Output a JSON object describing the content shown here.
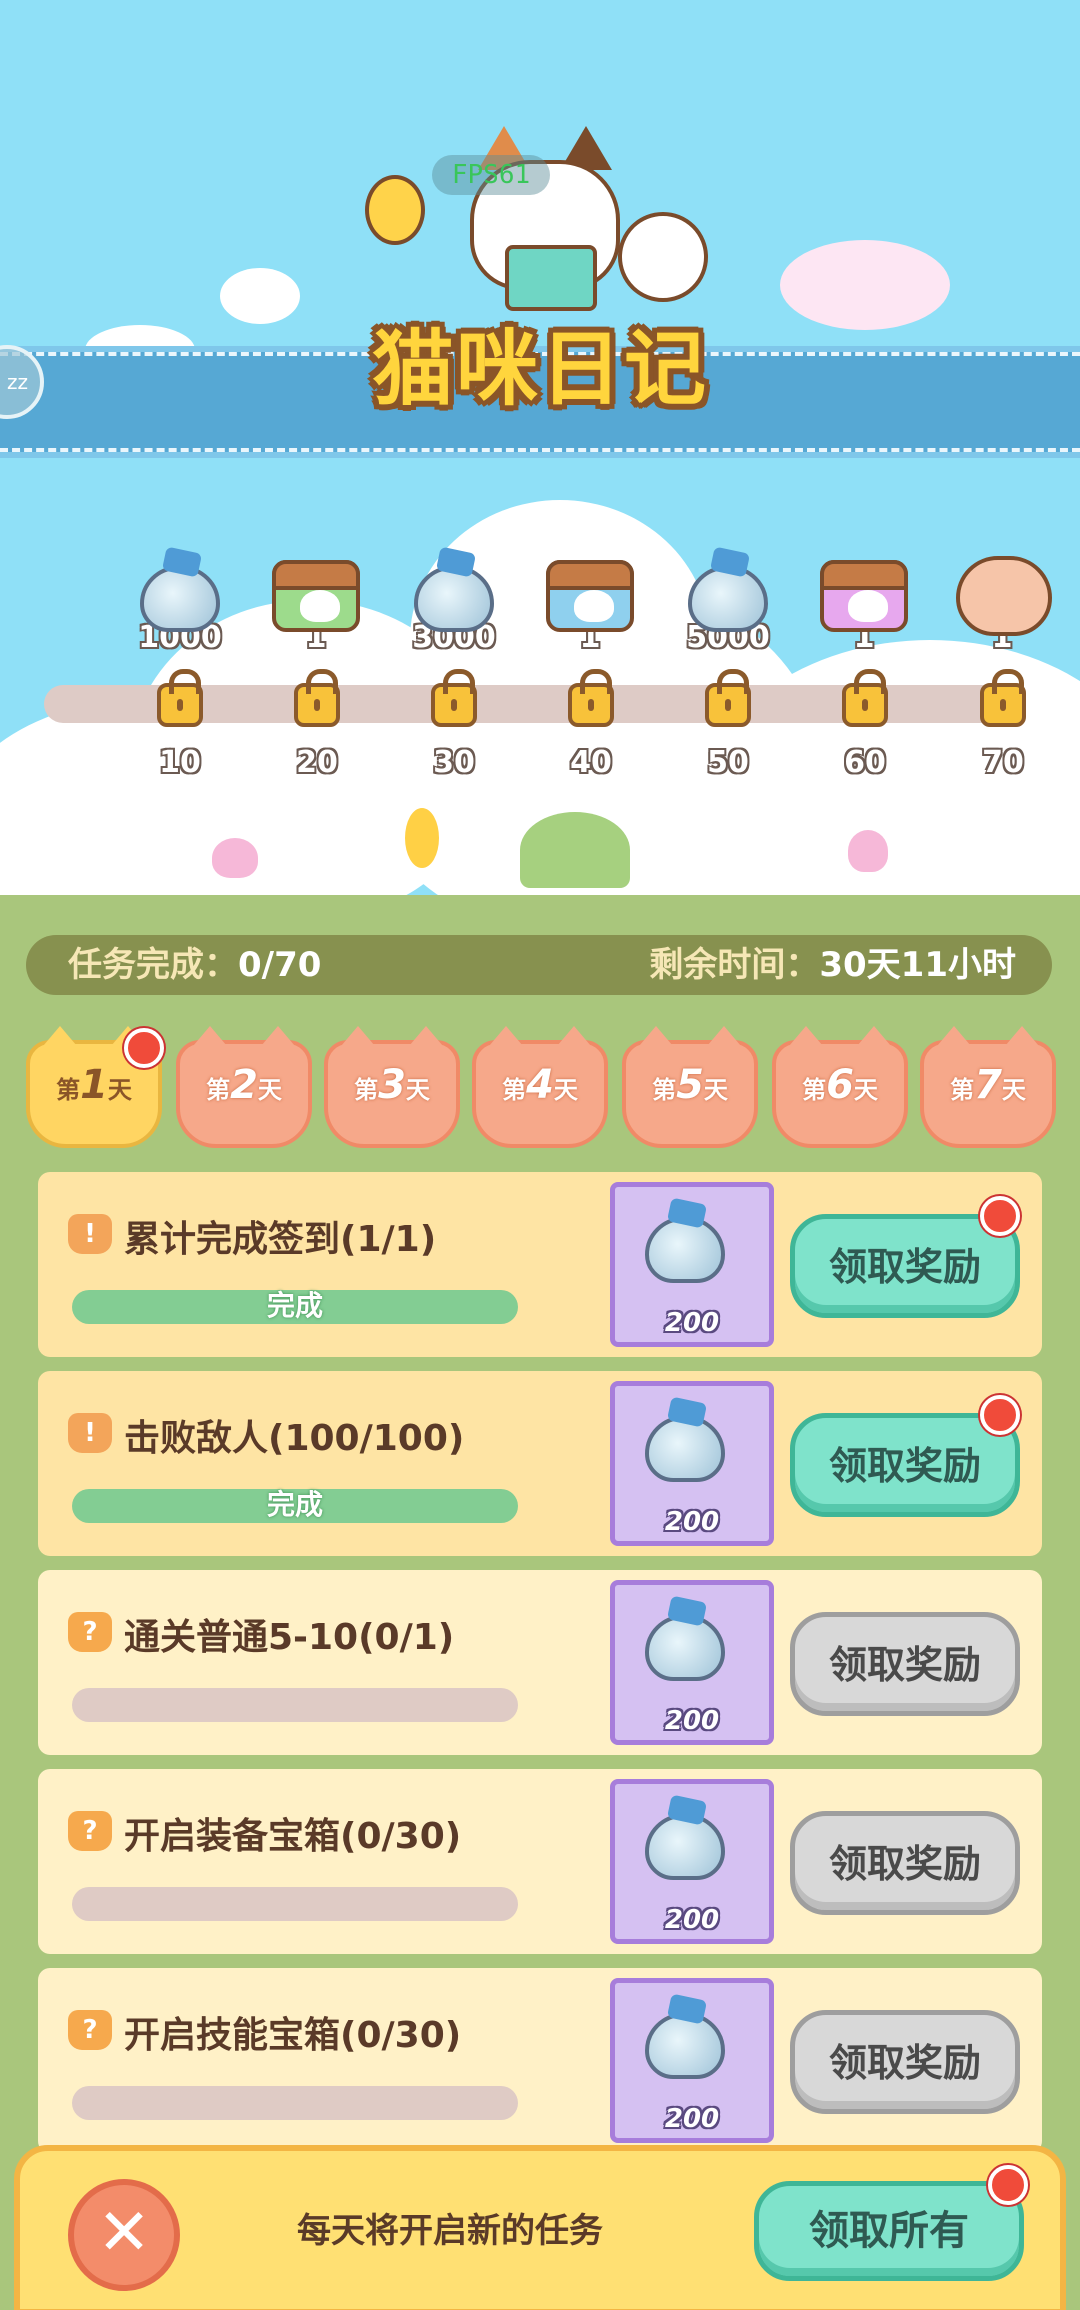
{
  "overlay": {
    "fps": "FPS61"
  },
  "side_button": {
    "label": "zz"
  },
  "header": {
    "title": "猫咪日记"
  },
  "track": {
    "rewards": [
      {
        "type": "diamond-bag",
        "amount": "1000"
      },
      {
        "type": "green-chest",
        "amount": "1"
      },
      {
        "type": "diamond-bag",
        "amount": "3000"
      },
      {
        "type": "blue-chest",
        "amount": "1"
      },
      {
        "type": "diamond-bag",
        "amount": "5000"
      },
      {
        "type": "purple-chest",
        "amount": "1"
      },
      {
        "type": "cat",
        "amount": "1"
      }
    ],
    "milestones": [
      "10",
      "20",
      "30",
      "40",
      "50",
      "60",
      "70"
    ]
  },
  "status": {
    "progress_label": "任务完成：",
    "progress_value": "0/70",
    "time_label": "剩余时间：",
    "time_value": "30天11小时"
  },
  "days": [
    {
      "prefix": "第",
      "num": "1",
      "suffix": "天"
    },
    {
      "prefix": "第",
      "num": "2",
      "suffix": "天"
    },
    {
      "prefix": "第",
      "num": "3",
      "suffix": "天"
    },
    {
      "prefix": "第",
      "num": "4",
      "suffix": "天"
    },
    {
      "prefix": "第",
      "num": "5",
      "suffix": "天"
    },
    {
      "prefix": "第",
      "num": "6",
      "suffix": "天"
    },
    {
      "prefix": "第",
      "num": "7",
      "suffix": "天"
    }
  ],
  "tasks": [
    {
      "badge": "!",
      "title": "累计完成签到(1/1)",
      "bar_text": "完成",
      "progress": 1.0,
      "reward_amount": "200",
      "button": "领取奖励"
    },
    {
      "badge": "!",
      "title": "击败敌人(100/100)",
      "bar_text": "完成",
      "progress": 1.0,
      "reward_amount": "200",
      "button": "领取奖励"
    },
    {
      "badge": "?",
      "title": "通关普通5-10(0/1)",
      "bar_text": "",
      "progress": 0.0,
      "reward_amount": "200",
      "button": "领取奖励"
    },
    {
      "badge": "?",
      "title": "开启装备宝箱(0/30)",
      "bar_text": "",
      "progress": 0.0,
      "reward_amount": "200",
      "button": "领取奖励"
    },
    {
      "badge": "?",
      "title": "开启技能宝箱(0/30)",
      "bar_text": "",
      "progress": 0.0,
      "reward_amount": "200",
      "button": "领取奖励"
    }
  ],
  "footer": {
    "close_symbol": "✕",
    "hint": "每天将开启新的任务",
    "claim_all": "领取所有"
  },
  "colors": {
    "sky": "#8fe0f7",
    "grass": "#a9c67c",
    "title_fill": "#ffd53d",
    "claim_active": "#7fe3cb",
    "claim_disabled": "#d8d8d8",
    "notification_dot": "#f04b3a"
  }
}
